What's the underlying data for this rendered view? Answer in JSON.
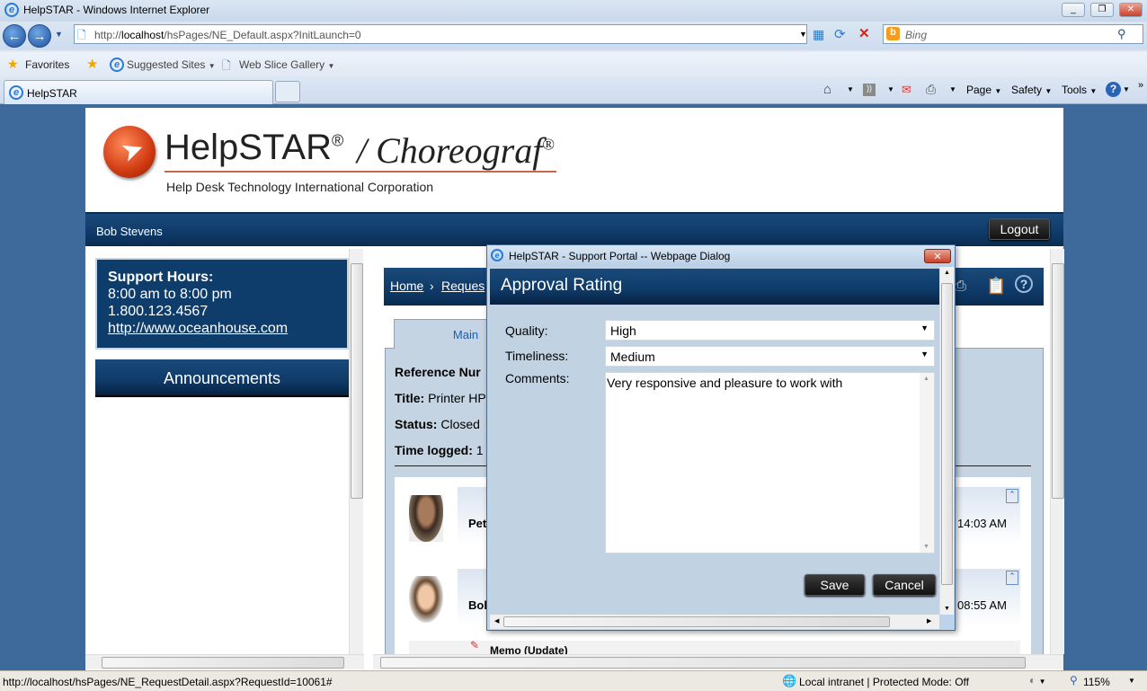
{
  "browser": {
    "window_title": "HelpSTAR - Windows Internet Explorer",
    "address_prefix": "http://",
    "address_host": "localhost",
    "address_path": "/hsPages/NE_Default.aspx?InitLaunch=0",
    "search_placeholder": "Bing",
    "favorites": {
      "label": "Favorites",
      "items": [
        {
          "label": "Suggested Sites"
        },
        {
          "label": "Web Slice Gallery"
        }
      ]
    },
    "tab_label": "HelpSTAR",
    "command_menus": [
      {
        "label": "Page"
      },
      {
        "label": "Safety"
      },
      {
        "label": "Tools"
      }
    ],
    "status": {
      "url": "http://localhost/hsPages/NE_RequestDetail.aspx?RequestId=10061#",
      "zone": "Local intranet | Protected Mode: Off",
      "zoom": "115%"
    }
  },
  "header": {
    "logo_brand": "HelpSTAR",
    "logo_product": "Choreograf",
    "logo_company": "Help Desk Technology International Corporation",
    "user_name": "Bob Stevens",
    "logout_label": "Logout"
  },
  "sidebar": {
    "support_title": "Support Hours:",
    "hours": "8:00 am to 8:00 pm",
    "phone": "1.800.123.4567",
    "website": "http://www.oceanhouse.com",
    "announcements_title": "Announcements"
  },
  "main": {
    "breadcrumb": [
      {
        "label": "Home"
      },
      {
        "label": "Reques"
      }
    ],
    "tab_main": "Main",
    "fields": [
      {
        "label": "Reference Nur",
        "value": ""
      },
      {
        "label": "Title:",
        "value": "Printer HP"
      },
      {
        "label": "Status:",
        "value": "Closed"
      },
      {
        "label": "Time logged:",
        "value": "1"
      }
    ],
    "entries": [
      {
        "author": "Pet",
        "time": "14:03 AM"
      },
      {
        "author": "Bob",
        "time": "08:55 AM"
      }
    ],
    "memo_label": "Memo (Update)"
  },
  "dialog": {
    "window_title": "HelpSTAR - Support Portal -- Webpage Dialog",
    "heading": "Approval Rating",
    "quality_label": "Quality:",
    "quality_value": "High",
    "timeliness_label": "Timeliness:",
    "timeliness_value": "Medium",
    "comments_label": "Comments:",
    "comments_value": "Very responsive and pleasure to work with",
    "save_label": "Save",
    "cancel_label": "Cancel"
  },
  "colors": {
    "brand_navy": "#0e3a68",
    "page_bg": "#3e6a9b",
    "dialog_bg": "#c1d2e2"
  }
}
